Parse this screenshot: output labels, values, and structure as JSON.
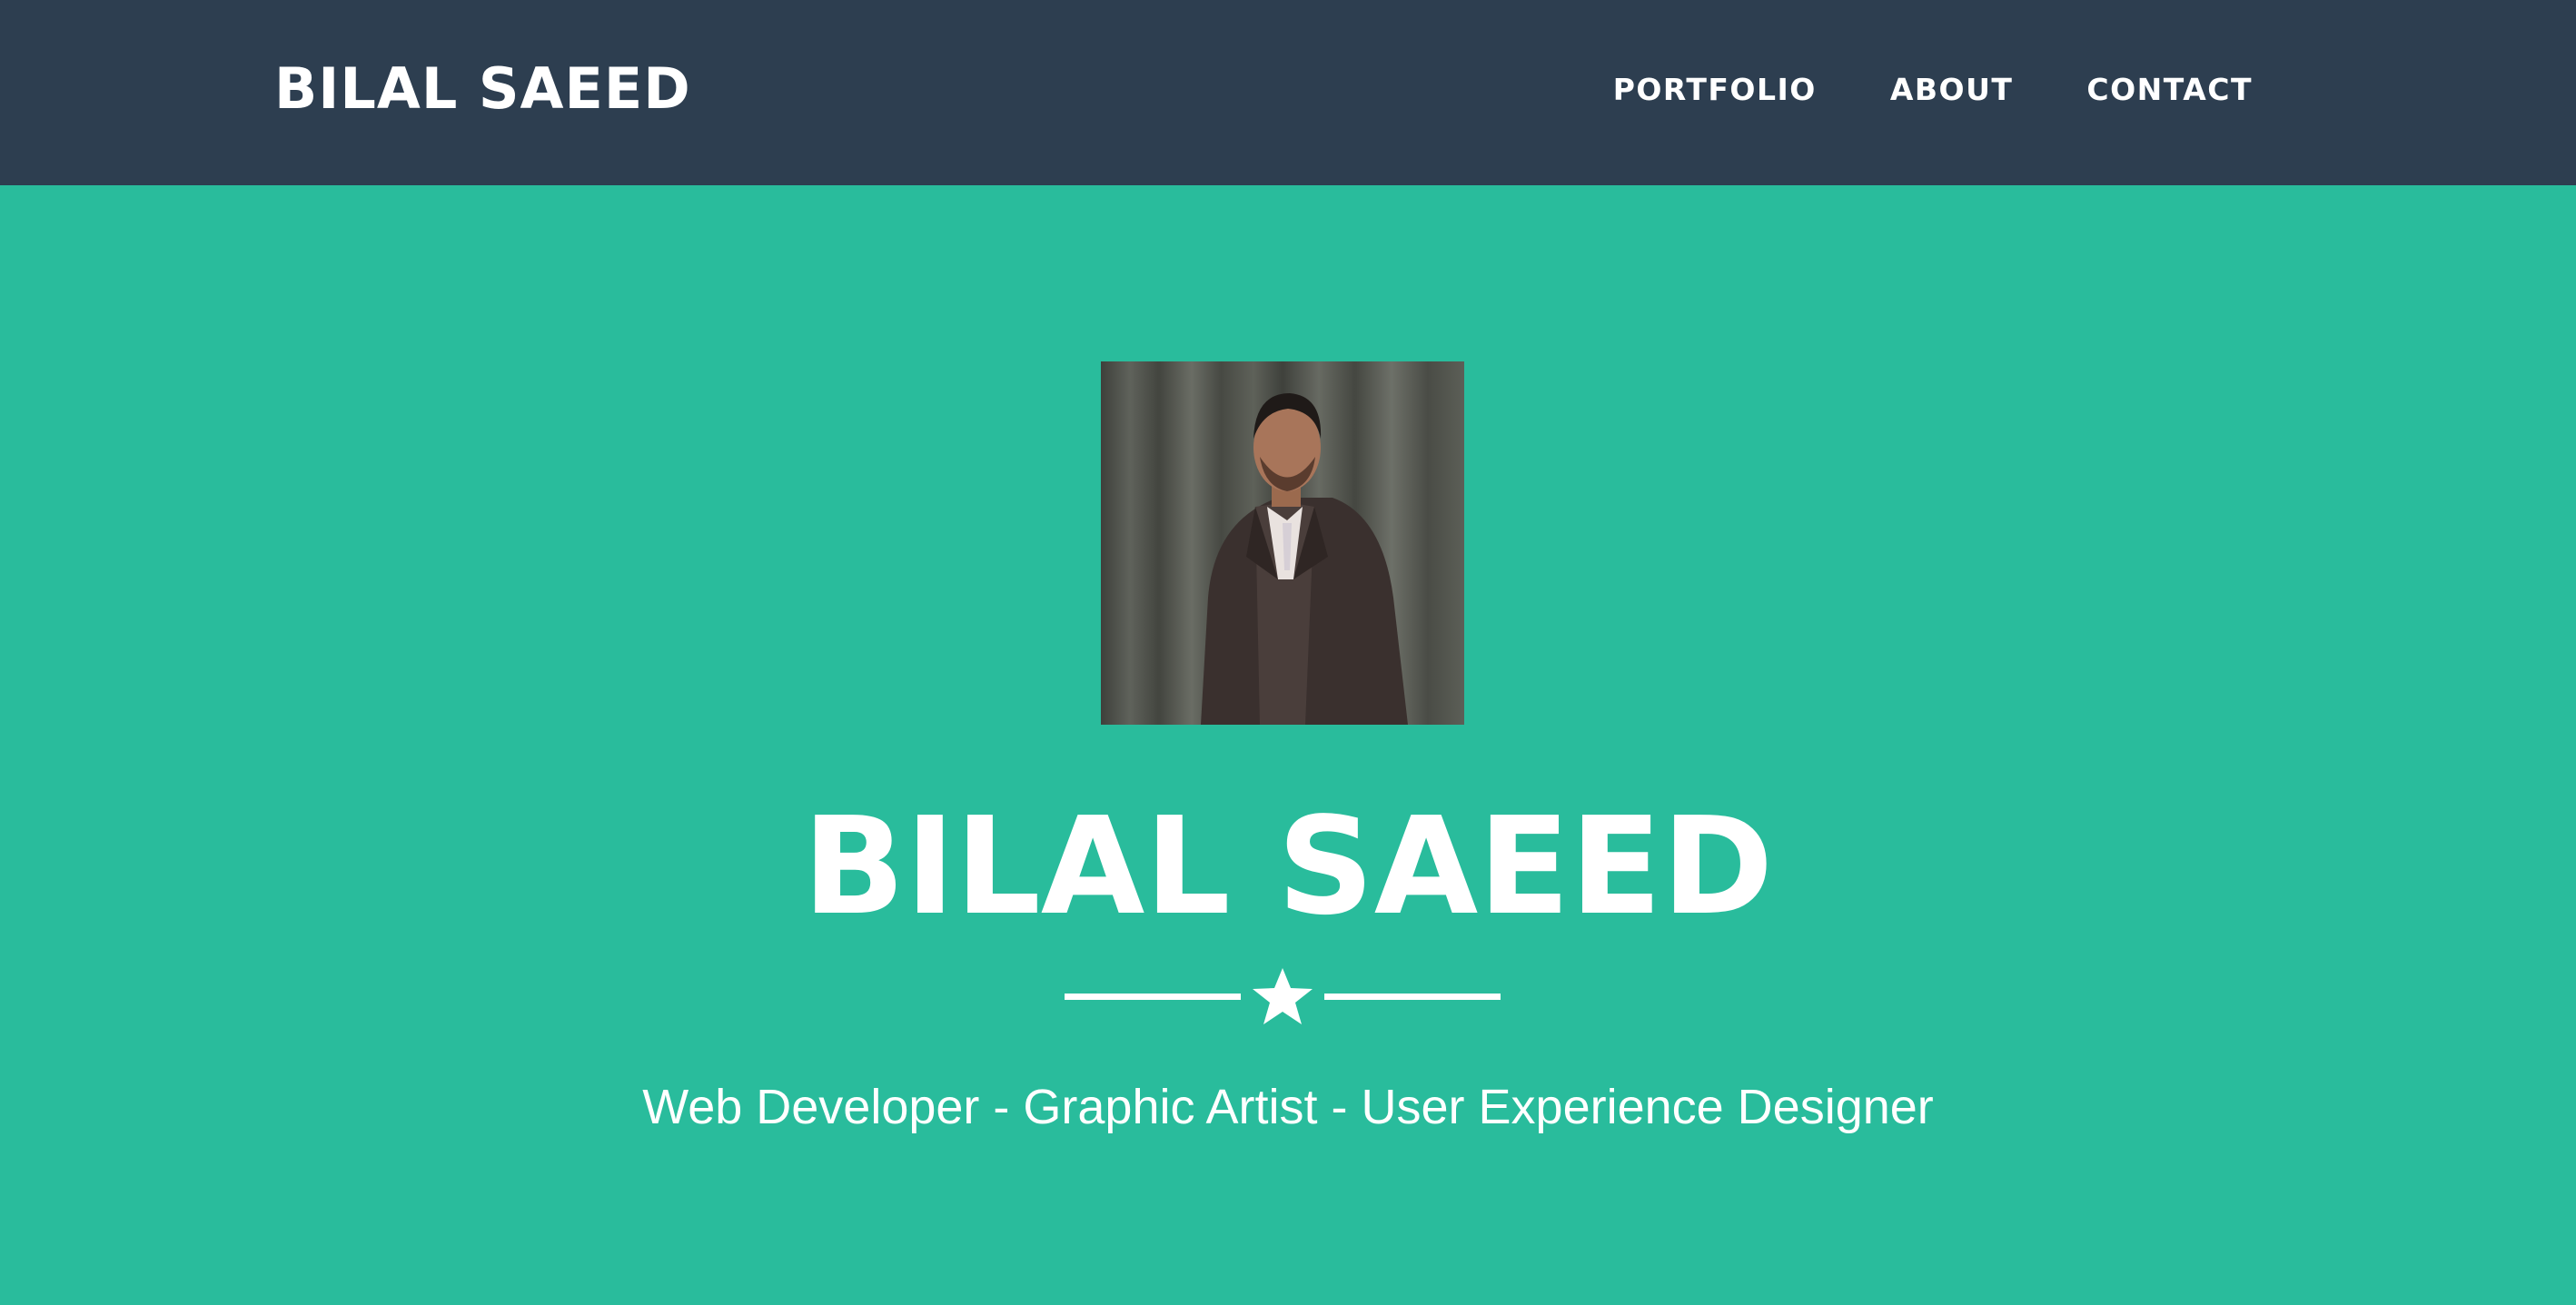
{
  "navbar": {
    "brand": "BILAL SAEED",
    "links": [
      {
        "label": "PORTFOLIO"
      },
      {
        "label": "ABOUT"
      },
      {
        "label": "CONTACT"
      }
    ]
  },
  "hero": {
    "profile_image_alt": "Bilal Saeed",
    "name": "BILAL SAEED",
    "divider_icon": "star-icon",
    "subtitle": "Web Developer - Graphic Artist - User Experience Designer"
  },
  "colors": {
    "navbar_bg": "#2d3e50",
    "hero_bg": "#29bc9c",
    "text": "#ffffff"
  }
}
